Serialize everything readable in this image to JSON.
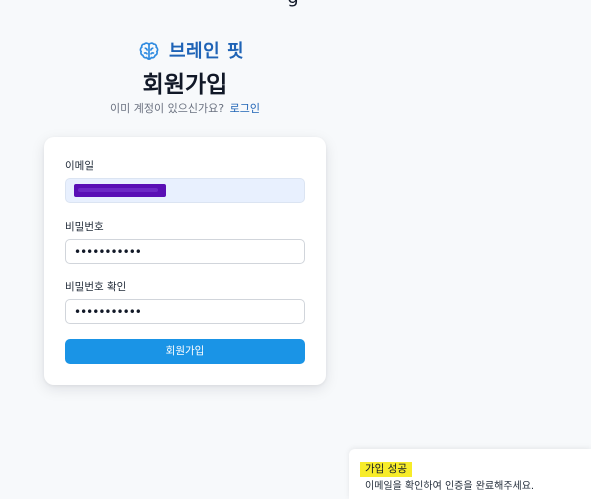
{
  "brand": {
    "name": "브레인 핏",
    "logo_icon": "brain-icon",
    "accent_color": "#1e63b6"
  },
  "page": {
    "title": "회원가입",
    "subtitle_prefix": "이미 계정이 있으신가요?",
    "login_link": "로그인"
  },
  "form": {
    "email": {
      "label": "이메일",
      "value_redacted": true
    },
    "password": {
      "label": "비밀번호",
      "masked_value": "•••••••••••"
    },
    "password_confirm": {
      "label": "비밀번호 확인",
      "masked_value": "•••••••••••"
    },
    "submit_label": "회원가입",
    "submit_color": "#1a94e6"
  },
  "toast": {
    "title": "가입 성공",
    "message": "이메일을 확인하여 인증을 완료해주세요.",
    "highlight_color": "#f7ec2a"
  }
}
